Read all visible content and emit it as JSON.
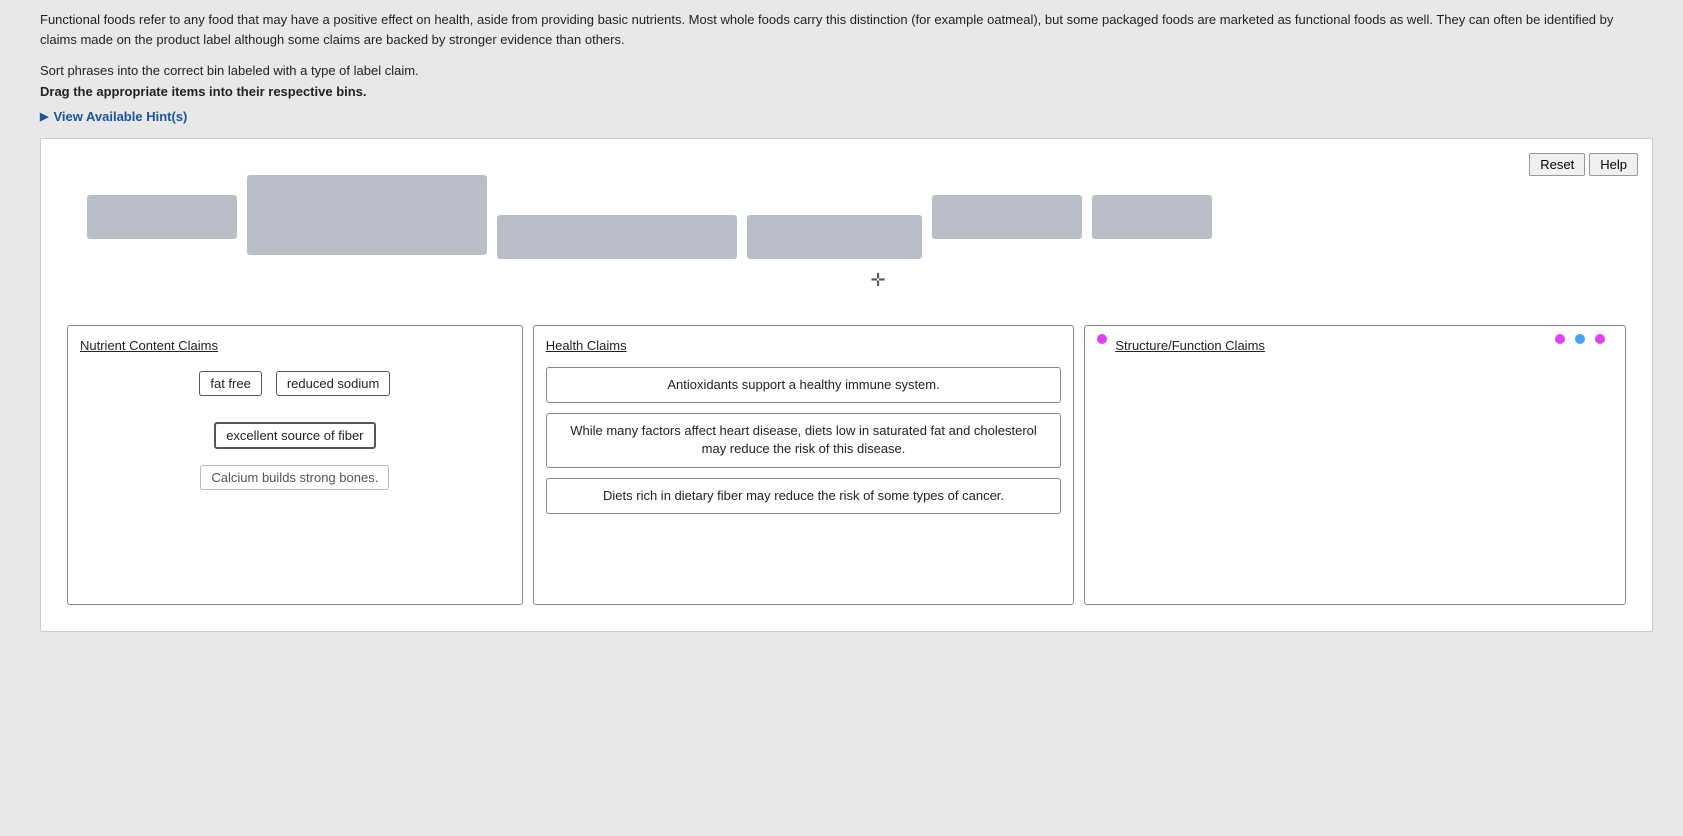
{
  "intro": {
    "text": "Functional foods refer to any food that may have a positive effect on health, aside from providing basic nutrients. Most whole foods carry this distinction (for example oatmeal), but some packaged foods are marketed as functional foods as well. They can often be identified by claims made on the product label although some claims are backed by stronger evidence than others.",
    "instruction1": "Sort phrases into the correct bin labeled with a type of label claim.",
    "instruction2": "Drag the appropriate items into their respective bins.",
    "hint_label": "View Available Hint(s)"
  },
  "buttons": {
    "reset": "Reset",
    "help": "Help"
  },
  "bins": {
    "nutrient": {
      "title": "Nutrient Content Claims",
      "items": [
        {
          "label": "fat free",
          "style": "tag"
        },
        {
          "label": "reduced sodium",
          "style": "tag"
        },
        {
          "label": "excellent source of fiber",
          "style": "tag-outline"
        },
        {
          "label": "Calcium builds strong bones.",
          "style": "tag-light"
        }
      ]
    },
    "health": {
      "title": "Health Claims",
      "cards": [
        {
          "text": "Antioxidants support a healthy immune system."
        },
        {
          "text": "While many factors affect heart disease, diets low in saturated fat and cholesterol may reduce the risk of this disease."
        },
        {
          "text": "Diets rich in dietary fiber may reduce the risk of some types of cancer."
        }
      ]
    },
    "structure": {
      "title": "Structure/Function Claims"
    }
  }
}
